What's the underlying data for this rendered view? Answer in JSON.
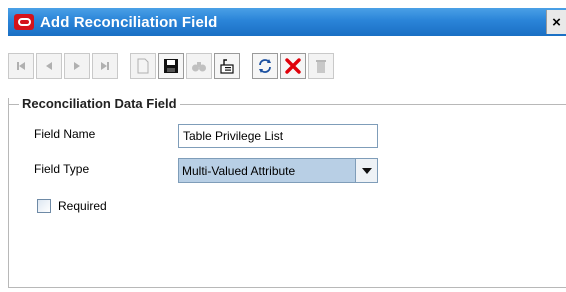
{
  "window": {
    "title": "Add Reconciliation Field",
    "close_label": "×"
  },
  "toolbar": {
    "buttons": [
      {
        "icon": "first-record-icon",
        "enabled": false
      },
      {
        "icon": "previous-record-icon",
        "enabled": false
      },
      {
        "icon": "next-record-icon",
        "enabled": false
      },
      {
        "icon": "last-record-icon",
        "enabled": false
      },
      {
        "icon": "new-document-icon",
        "enabled": false
      },
      {
        "icon": "save-icon",
        "enabled": true
      },
      {
        "icon": "find-icon",
        "enabled": false
      },
      {
        "icon": "query-icon",
        "enabled": true
      },
      {
        "icon": "refresh-icon",
        "enabled": true
      },
      {
        "icon": "delete-icon",
        "enabled": true
      },
      {
        "icon": "trash-icon",
        "enabled": false
      }
    ]
  },
  "section": {
    "title": "Reconciliation Data Field"
  },
  "form": {
    "field_name_label": "Field Name",
    "field_name_value": "Table Privilege List",
    "field_type_label": "Field Type",
    "field_type_value": "Multi-Valued Attribute",
    "required_label": "Required",
    "required_checked": false
  },
  "colors": {
    "title_bar": "#2a84d8",
    "logo_red": "#d4131b",
    "select_highlight": "#b8cfe5",
    "delete_red": "#e0000a"
  }
}
